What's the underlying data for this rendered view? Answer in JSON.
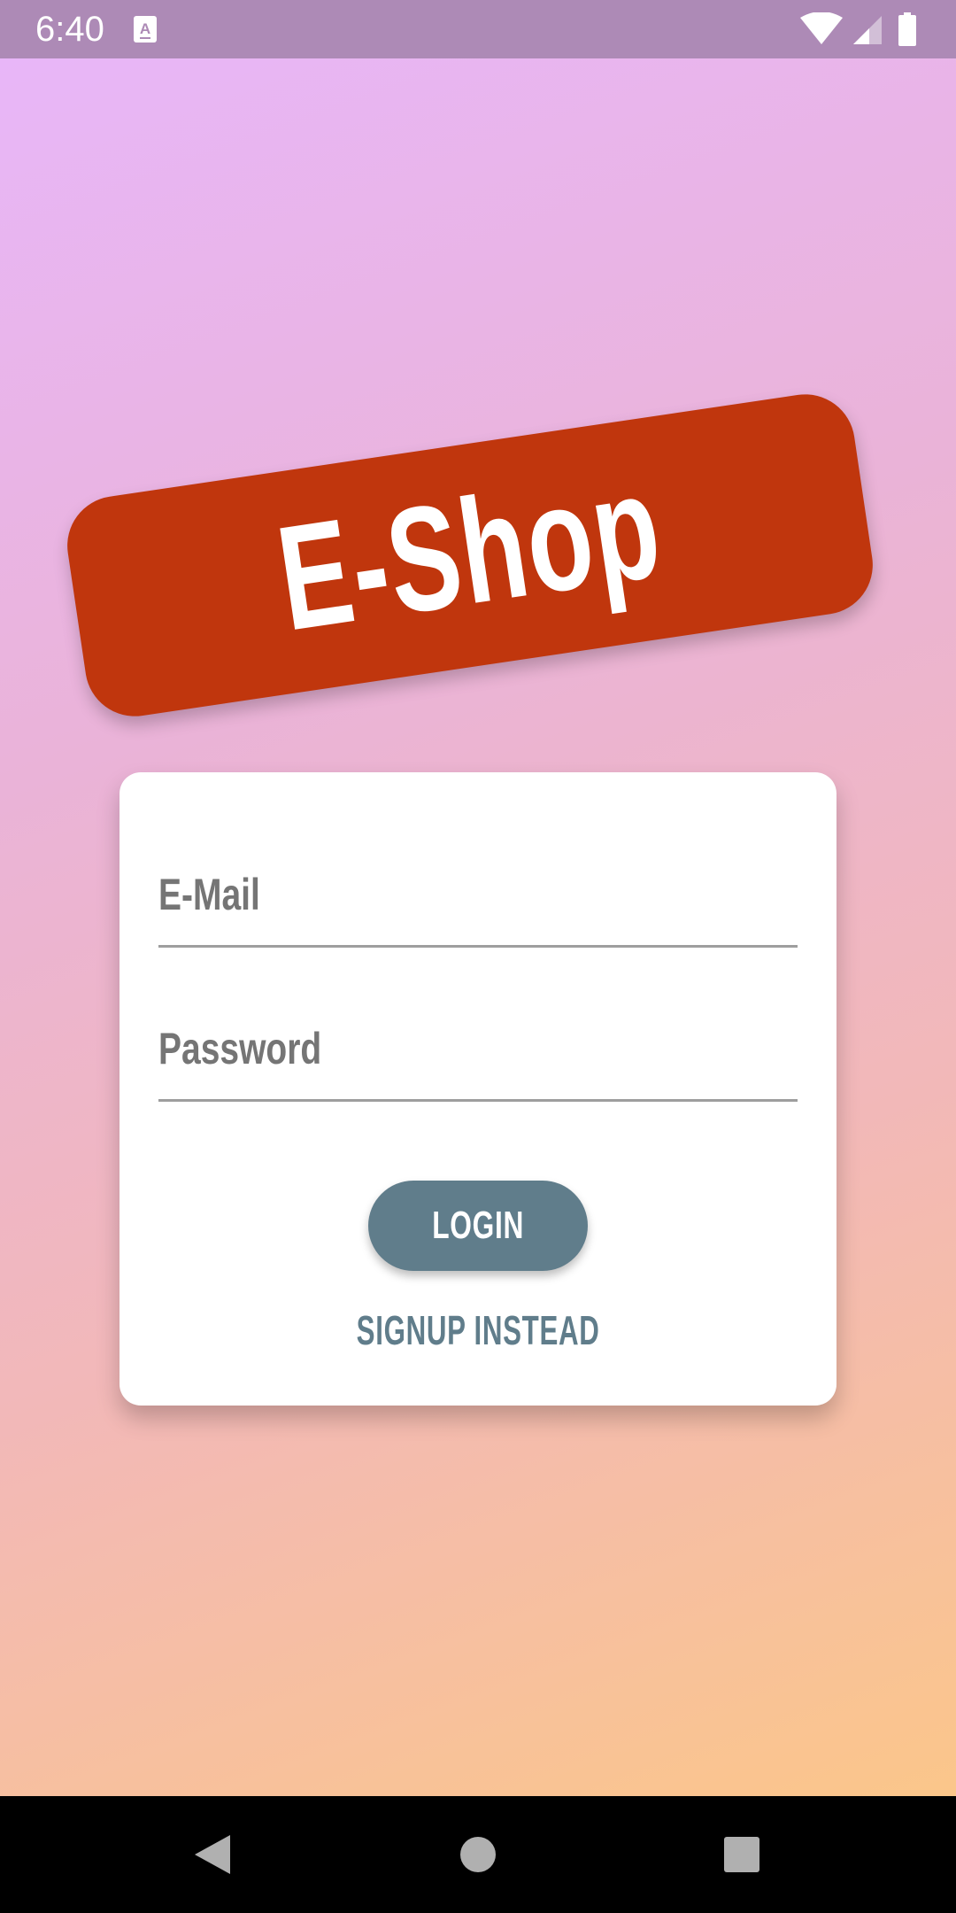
{
  "status_bar": {
    "time": "6:40",
    "notification_icon": "accessibility-a-icon",
    "icons": [
      "wifi-icon",
      "cell-signal-icon",
      "battery-icon"
    ],
    "background_color": "#ad8ab6"
  },
  "logo": {
    "text": "E-Shop",
    "background_color": "#c0360d"
  },
  "login_form": {
    "email_placeholder": "E-Mail",
    "password_placeholder": "Password",
    "login_label": "LOGIN",
    "signup_label": "SIGNUP INSTEAD",
    "accent_color": "#607d8b"
  },
  "nav_bar": {
    "buttons": [
      "back-icon",
      "home-icon",
      "recents-icon"
    ]
  },
  "theme": {
    "gradient_colors": [
      "#e8b6f8",
      "#eab3d8",
      "#f2b8b9",
      "#fbc68a"
    ]
  }
}
